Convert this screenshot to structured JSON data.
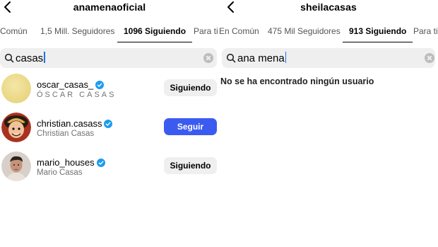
{
  "left": {
    "header_title": "anamenaoficial",
    "tabs": [
      "Común",
      "1,5 Mill. Seguidores",
      "1096 Siguiendo",
      "Para ti"
    ],
    "search": {
      "value": "casas"
    },
    "users": [
      {
        "username": "oscar_casas_",
        "fullname": "ÓSCAR CASAS",
        "button": "Siguiendo"
      },
      {
        "username": "christian.casass",
        "fullname": "Christian Casas",
        "button": "Seguir"
      },
      {
        "username": "mario_houses",
        "fullname": "Mario Casas",
        "button": "Siguiendo"
      }
    ]
  },
  "right": {
    "header_title": "sheilacasas",
    "tabs": [
      "En Común",
      "475 Mil Seguidores",
      "913 Siguiendo",
      "Para ti"
    ],
    "search": {
      "value": "ana mena"
    },
    "no_results": "No se ha encontrado ningún usuario"
  },
  "colors": {
    "follow_blue": "#3b5bf0",
    "verified_blue": "#1d9bf0",
    "search_bg": "#efefef"
  },
  "icons": {
    "back": "chevron-left-icon",
    "search": "search-icon",
    "clear": "clear-icon",
    "verified": "verified-badge-icon"
  }
}
